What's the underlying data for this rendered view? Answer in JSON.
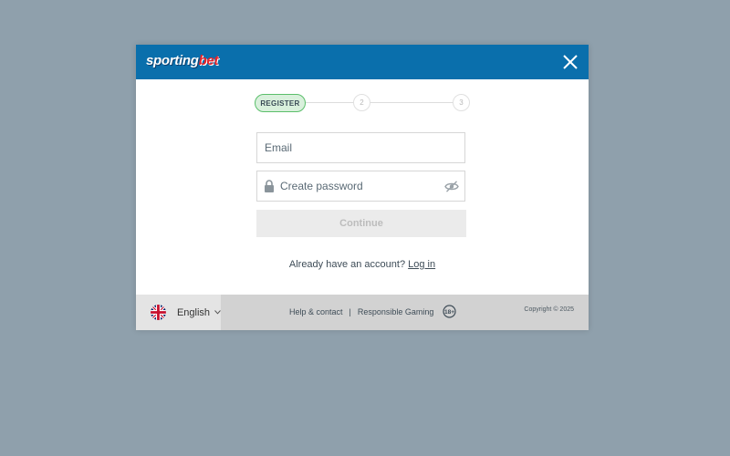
{
  "header": {
    "logo_main": "sporting",
    "logo_accent": "bet",
    "close_icon": "close-icon"
  },
  "stepper": {
    "active_label": "REGISTER",
    "step2": "2",
    "step3": "3",
    "active_color": "#5bbf6b"
  },
  "form": {
    "email_placeholder": "Email",
    "password_placeholder": "Create password",
    "continue_label": "Continue"
  },
  "login": {
    "prompt": "Already have an account?",
    "link": "Log in"
  },
  "footer": {
    "language": "English",
    "help_link": "Help & contact",
    "separator": "|",
    "responsible_link": "Responsible Gaming",
    "age_badge": "18+",
    "copyright": "Copyright © 2025"
  },
  "colors": {
    "brand_blue": "#0a6fac",
    "backdrop": "#8fa0ac",
    "accent_red": "#e6232a"
  }
}
